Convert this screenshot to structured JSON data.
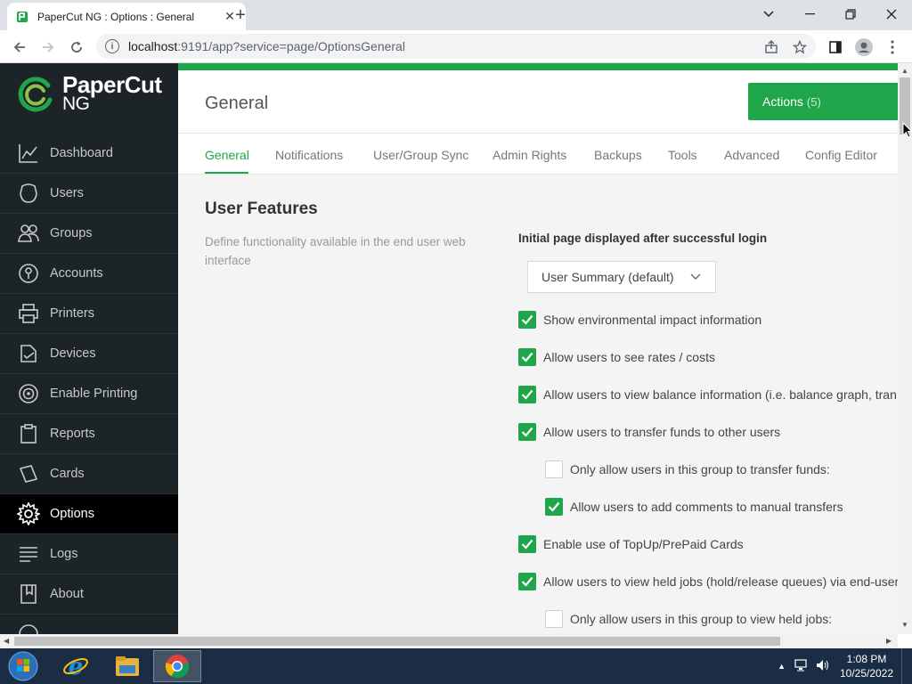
{
  "browser": {
    "tab_title": "PaperCut NG : Options : General",
    "url_host": "localhost",
    "url_rest": ":9191/app?service=page/OptionsGeneral"
  },
  "sidebar": {
    "logo_word": "PaperCut",
    "logo_sub": "NG",
    "items": [
      {
        "label": "Dashboard",
        "icon": "chart-icon"
      },
      {
        "label": "Users",
        "icon": "user-icon"
      },
      {
        "label": "Groups",
        "icon": "groups-icon"
      },
      {
        "label": "Accounts",
        "icon": "accounts-icon"
      },
      {
        "label": "Printers",
        "icon": "printer-icon"
      },
      {
        "label": "Devices",
        "icon": "devices-icon"
      },
      {
        "label": "Enable Printing",
        "icon": "enable-printing-icon"
      },
      {
        "label": "Reports",
        "icon": "reports-icon"
      },
      {
        "label": "Cards",
        "icon": "cards-icon"
      },
      {
        "label": "Options",
        "icon": "gear-icon"
      },
      {
        "label": "Logs",
        "icon": "logs-icon"
      },
      {
        "label": "About",
        "icon": "about-icon"
      }
    ],
    "active_item": "Options"
  },
  "header": {
    "title": "General",
    "actions_label": "Actions",
    "actions_count": "(5)"
  },
  "tabs": [
    "General",
    "Notifications",
    "User/Group Sync",
    "Admin Rights",
    "Backups",
    "Tools",
    "Advanced",
    "Config Editor"
  ],
  "active_tab": "General",
  "section": {
    "title": "User Features",
    "description": "Define functionality available in the end user web interface",
    "initial_page_label": "Initial page displayed after successful login",
    "initial_page_value": "User Summary (default)"
  },
  "checkboxes": [
    {
      "label": "Show environmental impact information",
      "checked": true,
      "indent": 0
    },
    {
      "label": "Allow users to see rates / costs",
      "checked": true,
      "indent": 0
    },
    {
      "label": "Allow users to view balance information (i.e. balance graph, tran",
      "checked": true,
      "indent": 0
    },
    {
      "label": "Allow users to transfer funds to other users",
      "checked": true,
      "indent": 0
    },
    {
      "label": "Only allow users in this group to transfer funds:",
      "checked": false,
      "indent": 1
    },
    {
      "label": "Allow users to add comments to manual transfers",
      "checked": true,
      "indent": 1
    },
    {
      "label": "Enable use of TopUp/PrePaid Cards",
      "checked": true,
      "indent": 0
    },
    {
      "label": "Allow users to view held jobs (hold/release queues) via end-user",
      "checked": true,
      "indent": 0
    },
    {
      "label": "Only allow users in this group to view held jobs:",
      "checked": false,
      "indent": 1
    }
  ],
  "taskbar": {
    "time": "1:08 PM",
    "date": "10/25/2022"
  },
  "colors": {
    "accent": "#1fa54a",
    "sidebar_bg": "#1d2428"
  }
}
